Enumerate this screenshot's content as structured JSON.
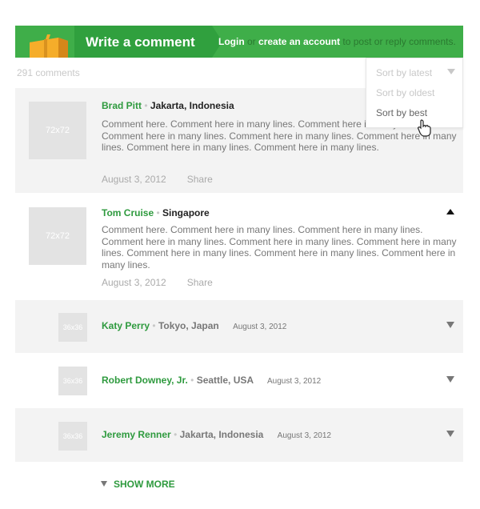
{
  "header": {
    "write_label": "Write a comment",
    "login_label": "Login",
    "or_label": "or",
    "create_label": "create an account",
    "suffix_label": "to post or reply comments."
  },
  "count_label": "291 comments",
  "sort": {
    "options": [
      "Sort by latest",
      "Sort by oldest",
      "Sort by best"
    ]
  },
  "comments": [
    {
      "avatar": "72x72",
      "name": "Brad Pitt",
      "location": "Jakarta, Indonesia",
      "text": "Comment here. Comment here in many lines. Comment here in many lines. Comment here in many lines. Comment here in many lines. Comment here in many lines. Comment here in many lines. Comment here in many lines.",
      "date": "August 3, 2012",
      "share": "Share"
    },
    {
      "avatar": "72x72",
      "name": "Tom Cruise",
      "location": "Singapore",
      "text": "Comment here. Comment here in many lines. Comment here in many lines. Comment here in many lines. Comment here in many lines. Comment here in many lines. Comment here in many lines. Comment here in many lines. Comment here in many lines.",
      "date": "August 3, 2012",
      "share": "Share"
    },
    {
      "avatar": "36x36",
      "name": "Katy Perry",
      "location": "Tokyo, Japan",
      "date": "August 3, 2012"
    },
    {
      "avatar": "36x36",
      "name": "Robert Downey, Jr.",
      "location": "Seattle, USA",
      "date": "August 3, 2012"
    },
    {
      "avatar": "36x36",
      "name": "Jeremy Renner",
      "location": "Jakarta, Indonesia",
      "date": "August 3, 2012"
    }
  ],
  "show_more": "SHOW MORE"
}
